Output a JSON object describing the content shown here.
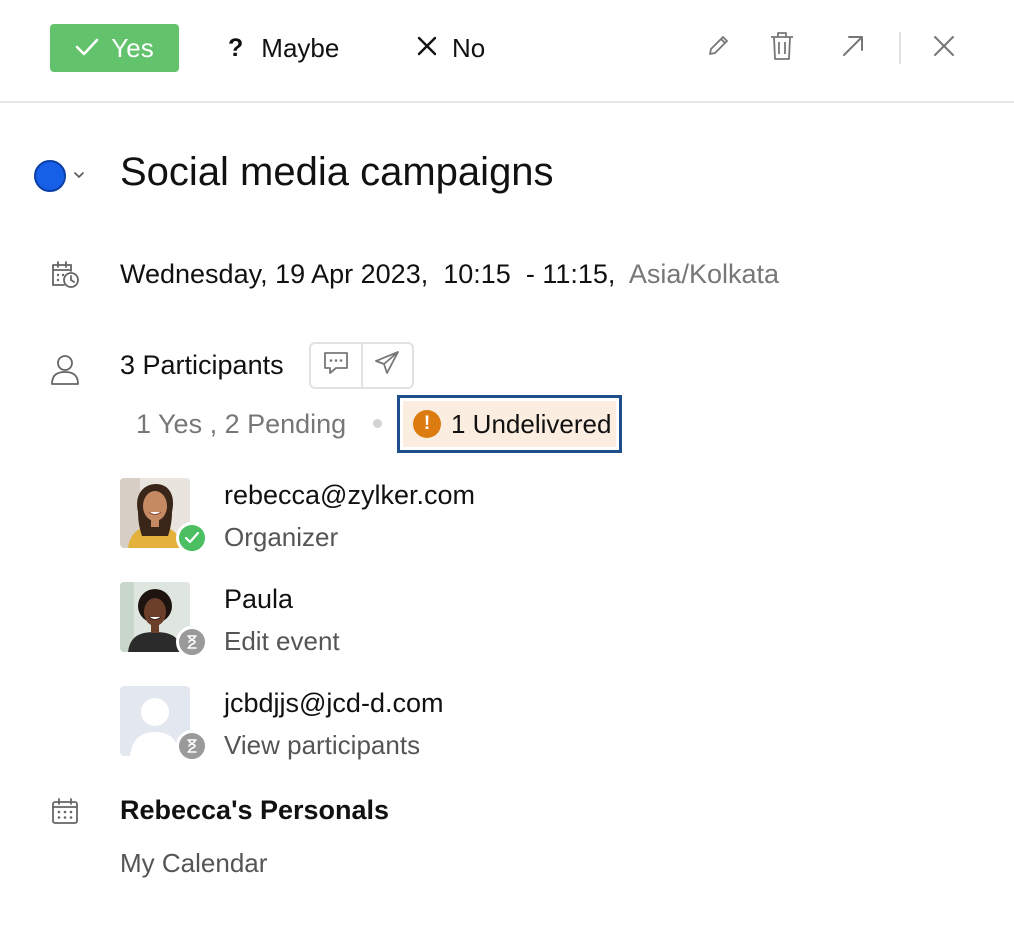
{
  "rsvp": {
    "yes_label": "Yes",
    "maybe_label": "Maybe",
    "no_label": "No"
  },
  "toolbar": {
    "icons": [
      "edit-icon",
      "delete-icon",
      "open-external-icon",
      "close-icon"
    ]
  },
  "event": {
    "color": "#1660e8",
    "title": "Social media campaigns",
    "date": "Wednesday, 19 Apr 2023,",
    "start_time": "10:15",
    "end_time": "- 11:15,",
    "timezone": "Asia/Kolkata"
  },
  "participants": {
    "label": "3 Participants",
    "summary": "1 Yes , 2 Pending",
    "undelivered": "1 Undelivered",
    "list": [
      {
        "name": "rebecca@zylker.com",
        "role": "Organizer",
        "status": "accepted"
      },
      {
        "name": "Paula",
        "role": "Edit event",
        "status": "pending"
      },
      {
        "name": "jcbdjjs@jcd-d.com",
        "role": "View participants",
        "status": "pending"
      }
    ]
  },
  "calendar": {
    "name": "Rebecca's Personals",
    "sub": "My Calendar"
  },
  "colors": {
    "yes_green": "#62c36c",
    "undelivered_bg": "#fbeee0",
    "warning_orange": "#dc7b0f",
    "highlight_border": "#1e4f8a"
  }
}
